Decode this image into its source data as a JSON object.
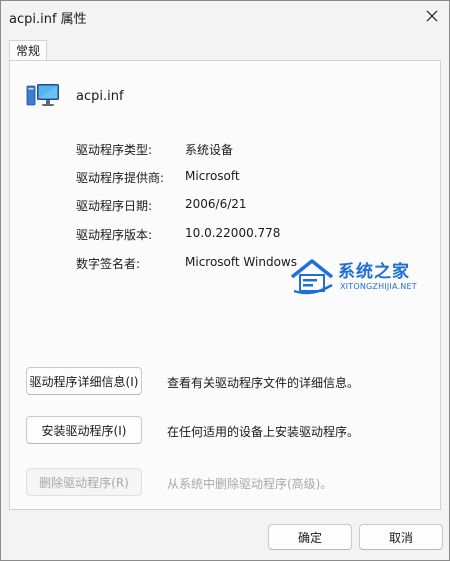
{
  "window": {
    "title": "acpi.inf 属性"
  },
  "tabs": [
    {
      "label": "常规"
    }
  ],
  "device": {
    "name": "acpi.inf",
    "icon": "monitor-computer-icon"
  },
  "properties": [
    {
      "label": "驱动程序类型:",
      "value": "系统设备"
    },
    {
      "label": "驱动程序提供商:",
      "value": "Microsoft"
    },
    {
      "label": "驱动程序日期:",
      "value": "2006/6/21"
    },
    {
      "label": "驱动程序版本:",
      "value": "10.0.22000.778"
    },
    {
      "label": "数字签名者:",
      "value": "Microsoft Windows"
    }
  ],
  "actions": [
    {
      "label": "驱动程序详细信息(I)",
      "description": "查看有关驱动程序文件的详细信息。",
      "enabled": true
    },
    {
      "label": "安装驱动程序(I)",
      "description": "在任何适用的设备上安装驱动程序。",
      "enabled": true
    },
    {
      "label": "删除驱动程序(R)",
      "description": "从系统中删除驱动程序(高级)。",
      "enabled": false
    }
  ],
  "dialog_buttons": {
    "ok": "确定",
    "cancel": "取消"
  },
  "watermark": {
    "brand": "系统之家",
    "url": "XITONGZHIJIA.NET",
    "color": "#1e6fd9"
  }
}
